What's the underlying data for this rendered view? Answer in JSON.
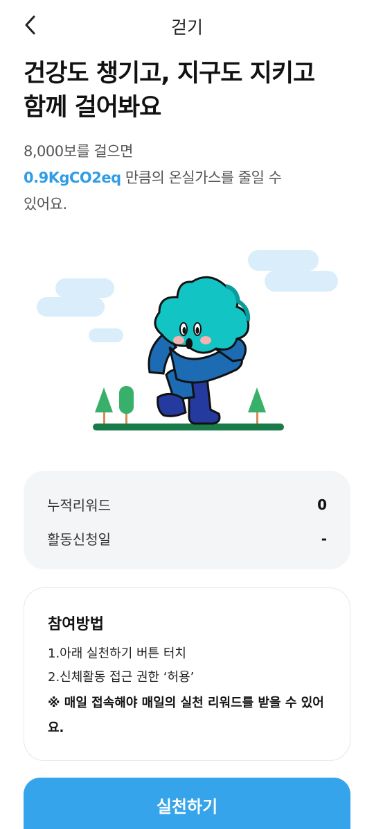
{
  "header": {
    "title": "걷기"
  },
  "headline": {
    "line1": "건강도 챙기고, 지구도 지키고",
    "line2": "함께 걸어봐요"
  },
  "description": {
    "line1": "8,000보를 걸으면",
    "highlight": "0.9KgCO2eq",
    "line2_rest": " 만큼의 온실가스를 줄일 수",
    "line3": "있어요."
  },
  "info": {
    "rows": [
      {
        "label": "누적리워드",
        "value": "0"
      },
      {
        "label": "활동신청일",
        "value": "-"
      }
    ]
  },
  "howto": {
    "title": "참여방법",
    "steps": [
      "1.아래 실천하기 버튼 터치",
      "2.신체활동 접근 권한 ‘허용’"
    ],
    "note": "※ 매일 접속해야 매일의 실천 리워드를 받을 수 있어요."
  },
  "cta": {
    "label": "실천하기"
  },
  "colors": {
    "accent": "#2e9de6",
    "button": "#35a4eb",
    "character": "#13c4c4"
  }
}
